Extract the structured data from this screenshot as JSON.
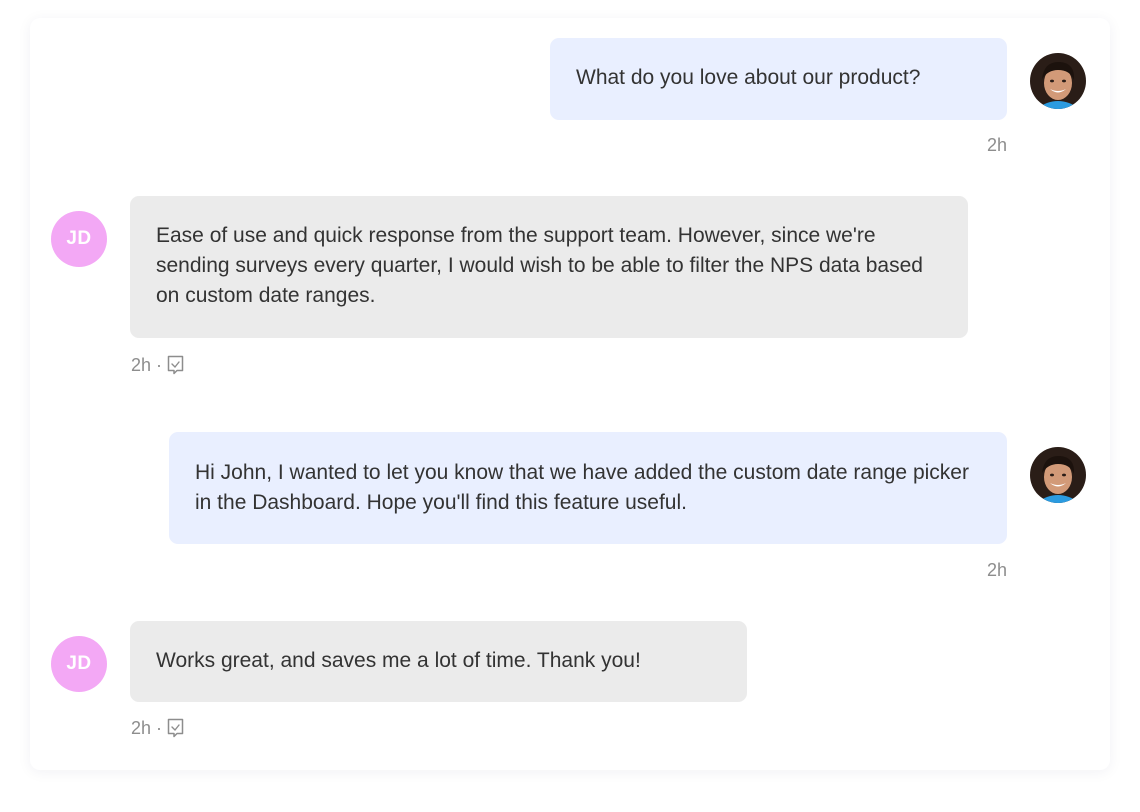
{
  "theme": {
    "outgoing_bg": "#e9efff",
    "incoming_bg": "#ebebeb",
    "initials_avatar_bg": "#f3a8f5",
    "meta_color": "#8d8d8d"
  },
  "messages": [
    {
      "direction": "outgoing",
      "text": "What do you love about our product?",
      "time": "2h",
      "avatar": "agent-photo"
    },
    {
      "direction": "incoming",
      "text": "Ease of use and quick response from the support team. However, since we're sending surveys every quarter, I would wish to be able to filter the NPS data based on custom date ranges.",
      "time": "2h",
      "separator": "·",
      "meta_icon": "survey-response-icon",
      "avatar_initials": "JD"
    },
    {
      "direction": "outgoing",
      "text": "Hi John, I wanted to let you know that we have added the custom date range picker in the Dashboard. Hope you'll find this feature useful.",
      "time": "2h",
      "avatar": "agent-photo"
    },
    {
      "direction": "incoming",
      "text": "Works great, and saves me a lot of time. Thank you!",
      "time": "2h",
      "separator": "·",
      "meta_icon": "survey-response-icon",
      "avatar_initials": "JD"
    }
  ]
}
